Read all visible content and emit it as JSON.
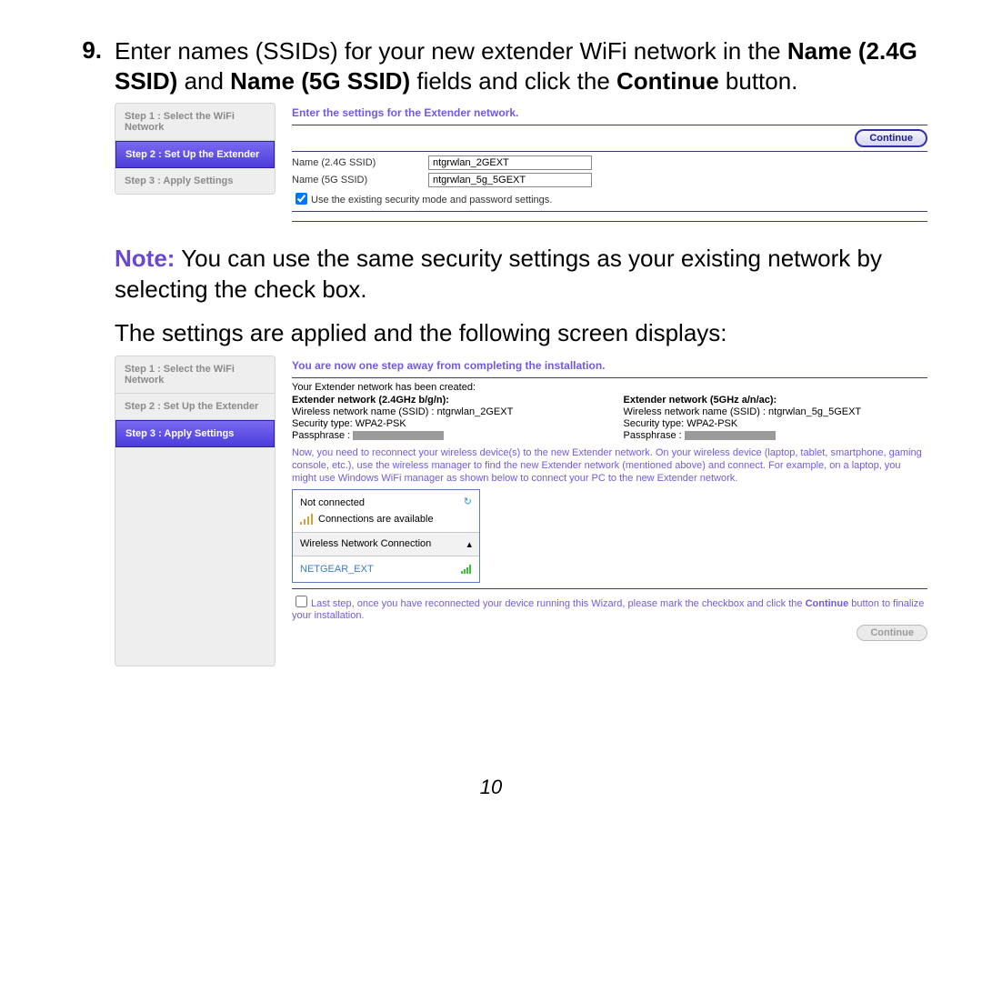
{
  "instruction": {
    "number": "9.",
    "pre": "Enter names (SSIDs) for your new extender WiFi network in the ",
    "bold1": "Name (2.4G SSID)",
    "mid1": " and ",
    "bold2": "Name (5G SSID)",
    "mid2": " fields and click the ",
    "bold3": "Continue",
    "post": " button."
  },
  "screenshot1": {
    "sidebar": {
      "step1": "Step 1 : Select the WiFi Network",
      "step2": "Step 2 : Set Up the Extender",
      "step3": "Step 3 : Apply Settings"
    },
    "title": "Enter the settings for the Extender network.",
    "continue_label": "Continue",
    "field1_label": "Name (2.4G SSID)",
    "field1_value": "ntgrwlan_2GEXT",
    "field2_label": "Name (5G SSID)",
    "field2_value": "ntgrwlan_5g_5GEXT",
    "checkbox_label": "Use the existing security mode and password settings."
  },
  "note": {
    "label": "Note:",
    "text": "  You can use the same security settings as your existing network by selecting the check box."
  },
  "followup": "The settings are applied and the following screen displays:",
  "screenshot2": {
    "sidebar": {
      "step1": "Step 1 : Select the WiFi Network",
      "step2": "Step 2 : Set Up the Extender",
      "step3": "Step 3 : Apply Settings"
    },
    "title": "You are now one step away from completing the installation.",
    "summary_heading": "Your Extender network has been created:",
    "col1": {
      "title": "Extender network (2.4GHz b/g/n):",
      "ssid": "Wireless network name (SSID) :  ntgrwlan_2GEXT",
      "security": "Security type: WPA2-PSK",
      "pass_label": "Passphrase :"
    },
    "col2": {
      "title": "Extender network (5GHz a/n/ac):",
      "ssid": "Wireless network name (SSID) :  ntgrwlan_5g_5GEXT",
      "security": "Security type: WPA2-PSK",
      "pass_label": "Passphrase :"
    },
    "para": "Now, you need to reconnect your wireless device(s) to the new Extender network. On your wireless device (laptop, tablet, smartphone, gaming console, etc.), use the wireless manager to find the new Extender network (mentioned above) and connect. For example, on a laptop, you might use Windows WiFi manager as shown below to connect your PC to the new Extender network.",
    "wifi": {
      "not_connected": "Not connected",
      "available": "Connections are available",
      "section": "Wireless Network Connection",
      "network": "NETGEAR_EXT"
    },
    "final_text_before": "Last step, once you have reconnected your device running this Wizard, please mark the checkbox and click the ",
    "final_bold": "Continue",
    "final_text_after": " button to finalize your installation.",
    "continue_label": "Continue"
  },
  "page_number": "10"
}
